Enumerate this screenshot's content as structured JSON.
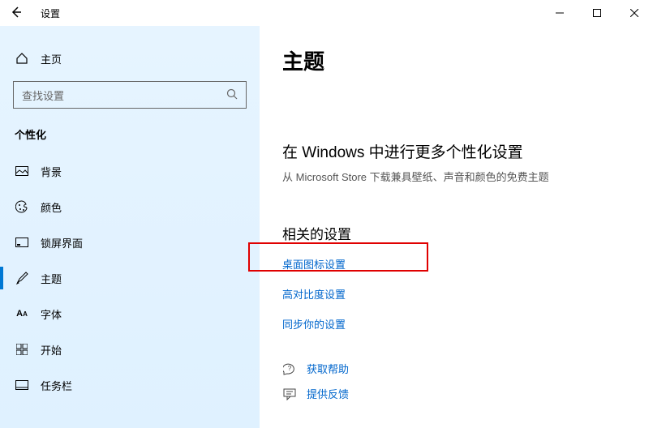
{
  "titlebar": {
    "title": "设置"
  },
  "sidebar": {
    "home": "主页",
    "search_placeholder": "查找设置",
    "section": "个性化",
    "items": [
      {
        "label": "背景"
      },
      {
        "label": "颜色"
      },
      {
        "label": "锁屏界面"
      },
      {
        "label": "主题"
      },
      {
        "label": "字体"
      },
      {
        "label": "开始"
      },
      {
        "label": "任务栏"
      }
    ]
  },
  "main": {
    "heading": "主题",
    "sub_heading": "在 Windows 中进行更多个性化设置",
    "sub_text": "从 Microsoft Store 下载兼具壁纸、声音和颜色的免费主题",
    "related_heading": "相关的设置",
    "links": {
      "desktop_icons": "桌面图标设置",
      "high_contrast": "高对比度设置",
      "sync": "同步你的设置"
    },
    "help": "获取帮助",
    "feedback": "提供反馈"
  }
}
